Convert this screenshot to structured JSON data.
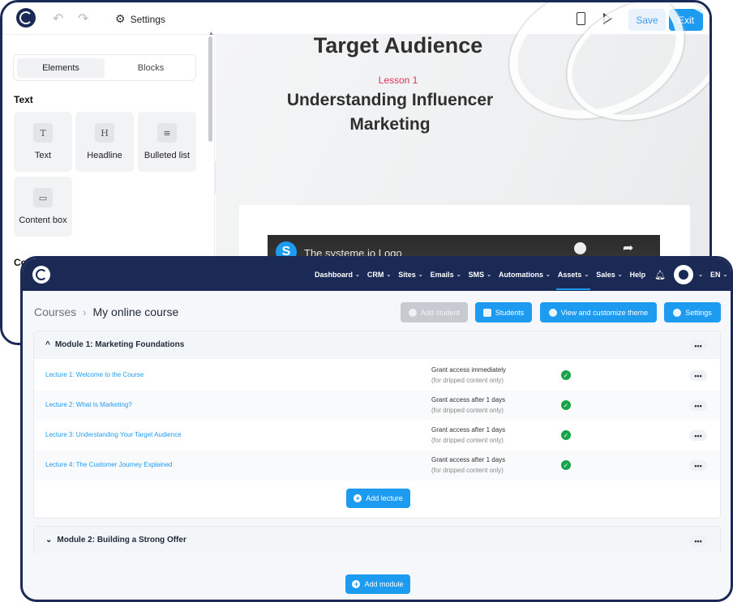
{
  "editor": {
    "settings_label": "Settings",
    "save_label": "Save",
    "exit_label": "Exit",
    "tabs": [
      "Elements",
      "Blocks"
    ],
    "section_text": "Text",
    "section_columns": "Columns",
    "elements": [
      {
        "label": "Text",
        "icon": "text-icon",
        "glyph": "T"
      },
      {
        "label": "Headline",
        "icon": "headline-icon",
        "glyph": "H"
      },
      {
        "label": "Bulleted list",
        "icon": "list-icon",
        "glyph": "≡"
      },
      {
        "label": "Content box",
        "icon": "content-box-icon",
        "glyph": "▭"
      }
    ],
    "canvas": {
      "title": "Target Audience",
      "lesson": "Lesson 1",
      "headline": "Understanding Influencer Marketing",
      "video_logo": "S",
      "video_title": "The systeme.io Logo"
    }
  },
  "course": {
    "nav": [
      {
        "label": "Dashboard",
        "caret": true
      },
      {
        "label": "CRM",
        "caret": true
      },
      {
        "label": "Sites",
        "caret": true
      },
      {
        "label": "Emails",
        "caret": true
      },
      {
        "label": "SMS",
        "caret": true
      },
      {
        "label": "Automations",
        "caret": true
      },
      {
        "label": "Assets",
        "caret": true,
        "active": true
      },
      {
        "label": "Sales",
        "caret": true
      },
      {
        "label": "Help",
        "caret": false
      }
    ],
    "language": "EN",
    "breadcrumb": {
      "parent": "Courses",
      "current": "My online course"
    },
    "buttons": {
      "add_student": "Add student",
      "students": "Students",
      "view_theme": "View and customize theme",
      "settings": "Settings",
      "add_lecture": "Add lecture",
      "add_module": "Add module"
    },
    "modules": [
      {
        "title": "Module 1: Marketing Foundations",
        "expanded": true,
        "lectures": [
          {
            "title": "Lecture 1: Welcome to the Course",
            "access": "Grant access immediately",
            "note": "(for dripped content only)"
          },
          {
            "title": "Lecture 2: What Is Marketing?",
            "access": "Grant access after 1 days",
            "note": "(for dripped content only)"
          },
          {
            "title": "Lecture 3: Understanding Your Target Audience",
            "access": "Grant access after 1 days",
            "note": "(for dripped content only)"
          },
          {
            "title": "Lecture 4: The Customer Journey Explained",
            "access": "Grant access after 1 days",
            "note": "(for dripped content only)"
          }
        ]
      },
      {
        "title": "Module 2: Building a Strong Offer",
        "expanded": false
      }
    ],
    "colors": {
      "brand": "#1b2a55",
      "accent": "#1d9bf0",
      "success": "#17a34a",
      "lesson": "#e0315f"
    }
  }
}
